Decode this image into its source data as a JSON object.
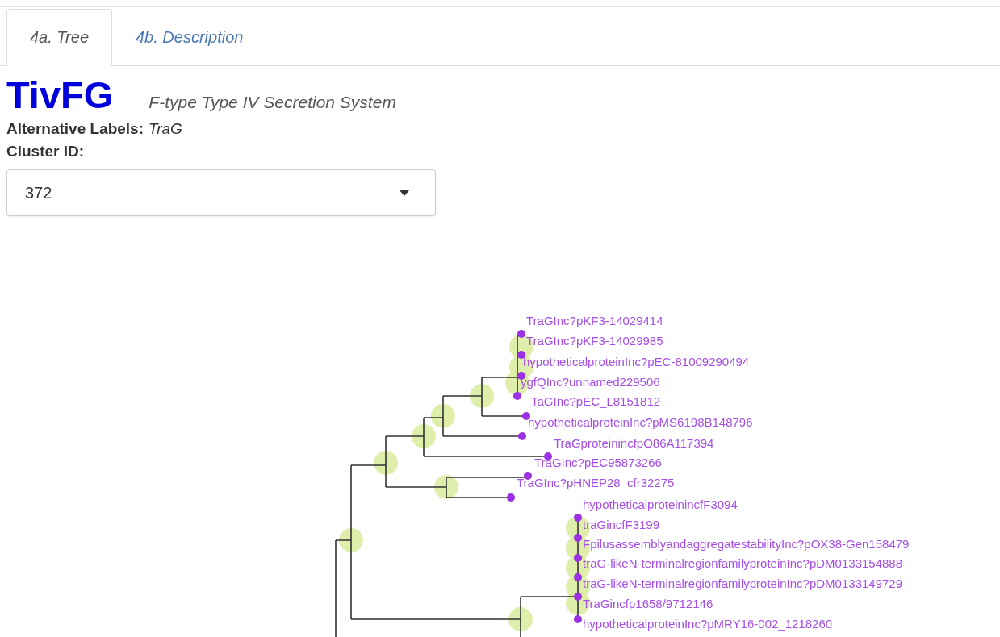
{
  "tabs": [
    {
      "label": "4a. Tree",
      "selected": true
    },
    {
      "label": "4b. Description",
      "selected": false
    }
  ],
  "title": "TivFG",
  "subtitle": "F-type Type IV Secretion System",
  "alternative_labels": {
    "label": "Alternative Labels:",
    "value": "TraG"
  },
  "cluster_id": {
    "label": "Cluster ID:",
    "value": "372"
  },
  "tree": {
    "leaves": [
      "TraGInc?pKF3-14029414",
      "TraGInc?pKF3-14029985",
      "hypotheticalproteinInc?pEC-81009290494",
      "ygfQInc?unnamed229506",
      "TaGInc?pEC_L8151812",
      "hypotheticalproteinInc?pMS6198B148796",
      "TraGproteinincfpO86A117394",
      "TraGInc?pEC95873266",
      "TraGInc?pHNEP28_cfr32275",
      "hypotheticalproteinincfF3094",
      "traGincfF3199",
      "FpilusassemblyandaggregatestabilityInc?pOX38-Gen158479",
      "traG-likeN-terminalregionfamilyproteinInc?pDM0133154888",
      "traG-likeN-terminalregionfamilyproteinInc?pDM0133149729",
      "TraGincfp1658/9712146",
      "hypotheticalproteinInc?pMRY16-002_1218260"
    ]
  }
}
